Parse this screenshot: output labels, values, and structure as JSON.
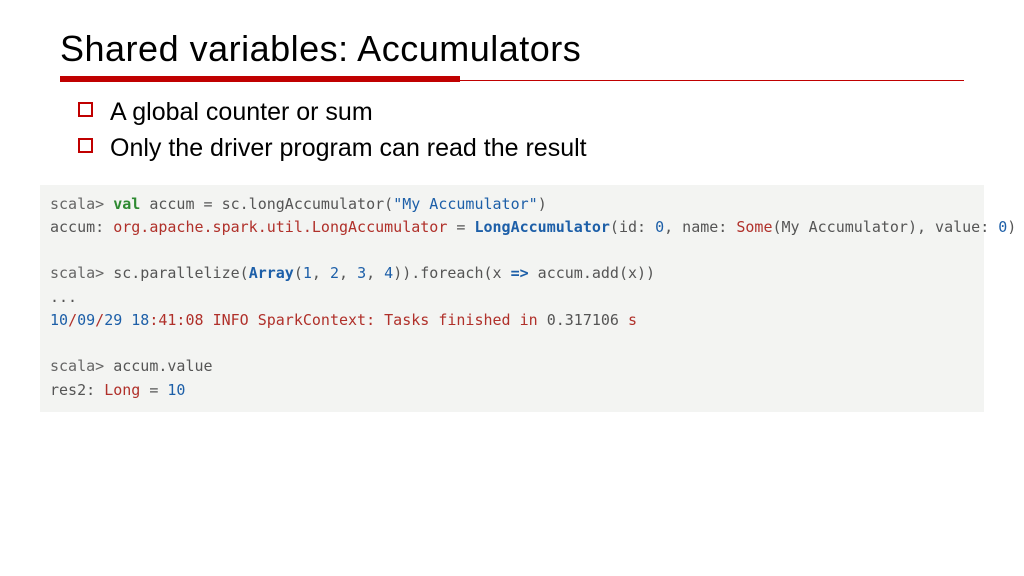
{
  "title": "Shared variables: Accumulators",
  "bullets": [
    "A global counter or sum",
    "Only the driver program can read the result"
  ],
  "code": {
    "l1": {
      "prompt": "scala>",
      "kw": "val",
      "rest1": " accum = sc.longAccumulator(",
      "str": "\"My Accumulator\"",
      "rest2": ")"
    },
    "l2": {
      "a": "accum: ",
      "type": "org.apache.spark.util.LongAccumulator",
      "eq": " = ",
      "ctor": "LongAccumulator",
      "p1": "(id: ",
      "id": "0",
      "p2": ", name: ",
      "some": "Some",
      "p3": "(My Accumulator), value: ",
      "val": "0",
      "p4": ")"
    },
    "l3": {
      "prompt": "scala>",
      "a": " sc.parallelize(",
      "arr": "Array",
      "p1": "(",
      "n1": "1",
      "c": ", ",
      "n2": "2",
      "n3": "3",
      "n4": "4",
      "p2": ")).foreach(x ",
      "arrow": "=>",
      "p3": " accum.add(x))"
    },
    "dots": "...",
    "l4": {
      "d1": "10",
      "s1": "/",
      "d2": "09",
      "s2": "/",
      "d3": "29",
      "sp": " ",
      "h": "18",
      "col": ":",
      "rest_time": "41:08 ",
      "info": "INFO",
      "ctx": " SparkContext: Tasks finished in ",
      "sec": "0.317106",
      "unit": " s"
    },
    "l5": {
      "prompt": "scala>",
      "rest": " accum.value"
    },
    "l6": {
      "a": "res2: ",
      "type": "Long",
      "eq": " = ",
      "val": "10"
    }
  }
}
